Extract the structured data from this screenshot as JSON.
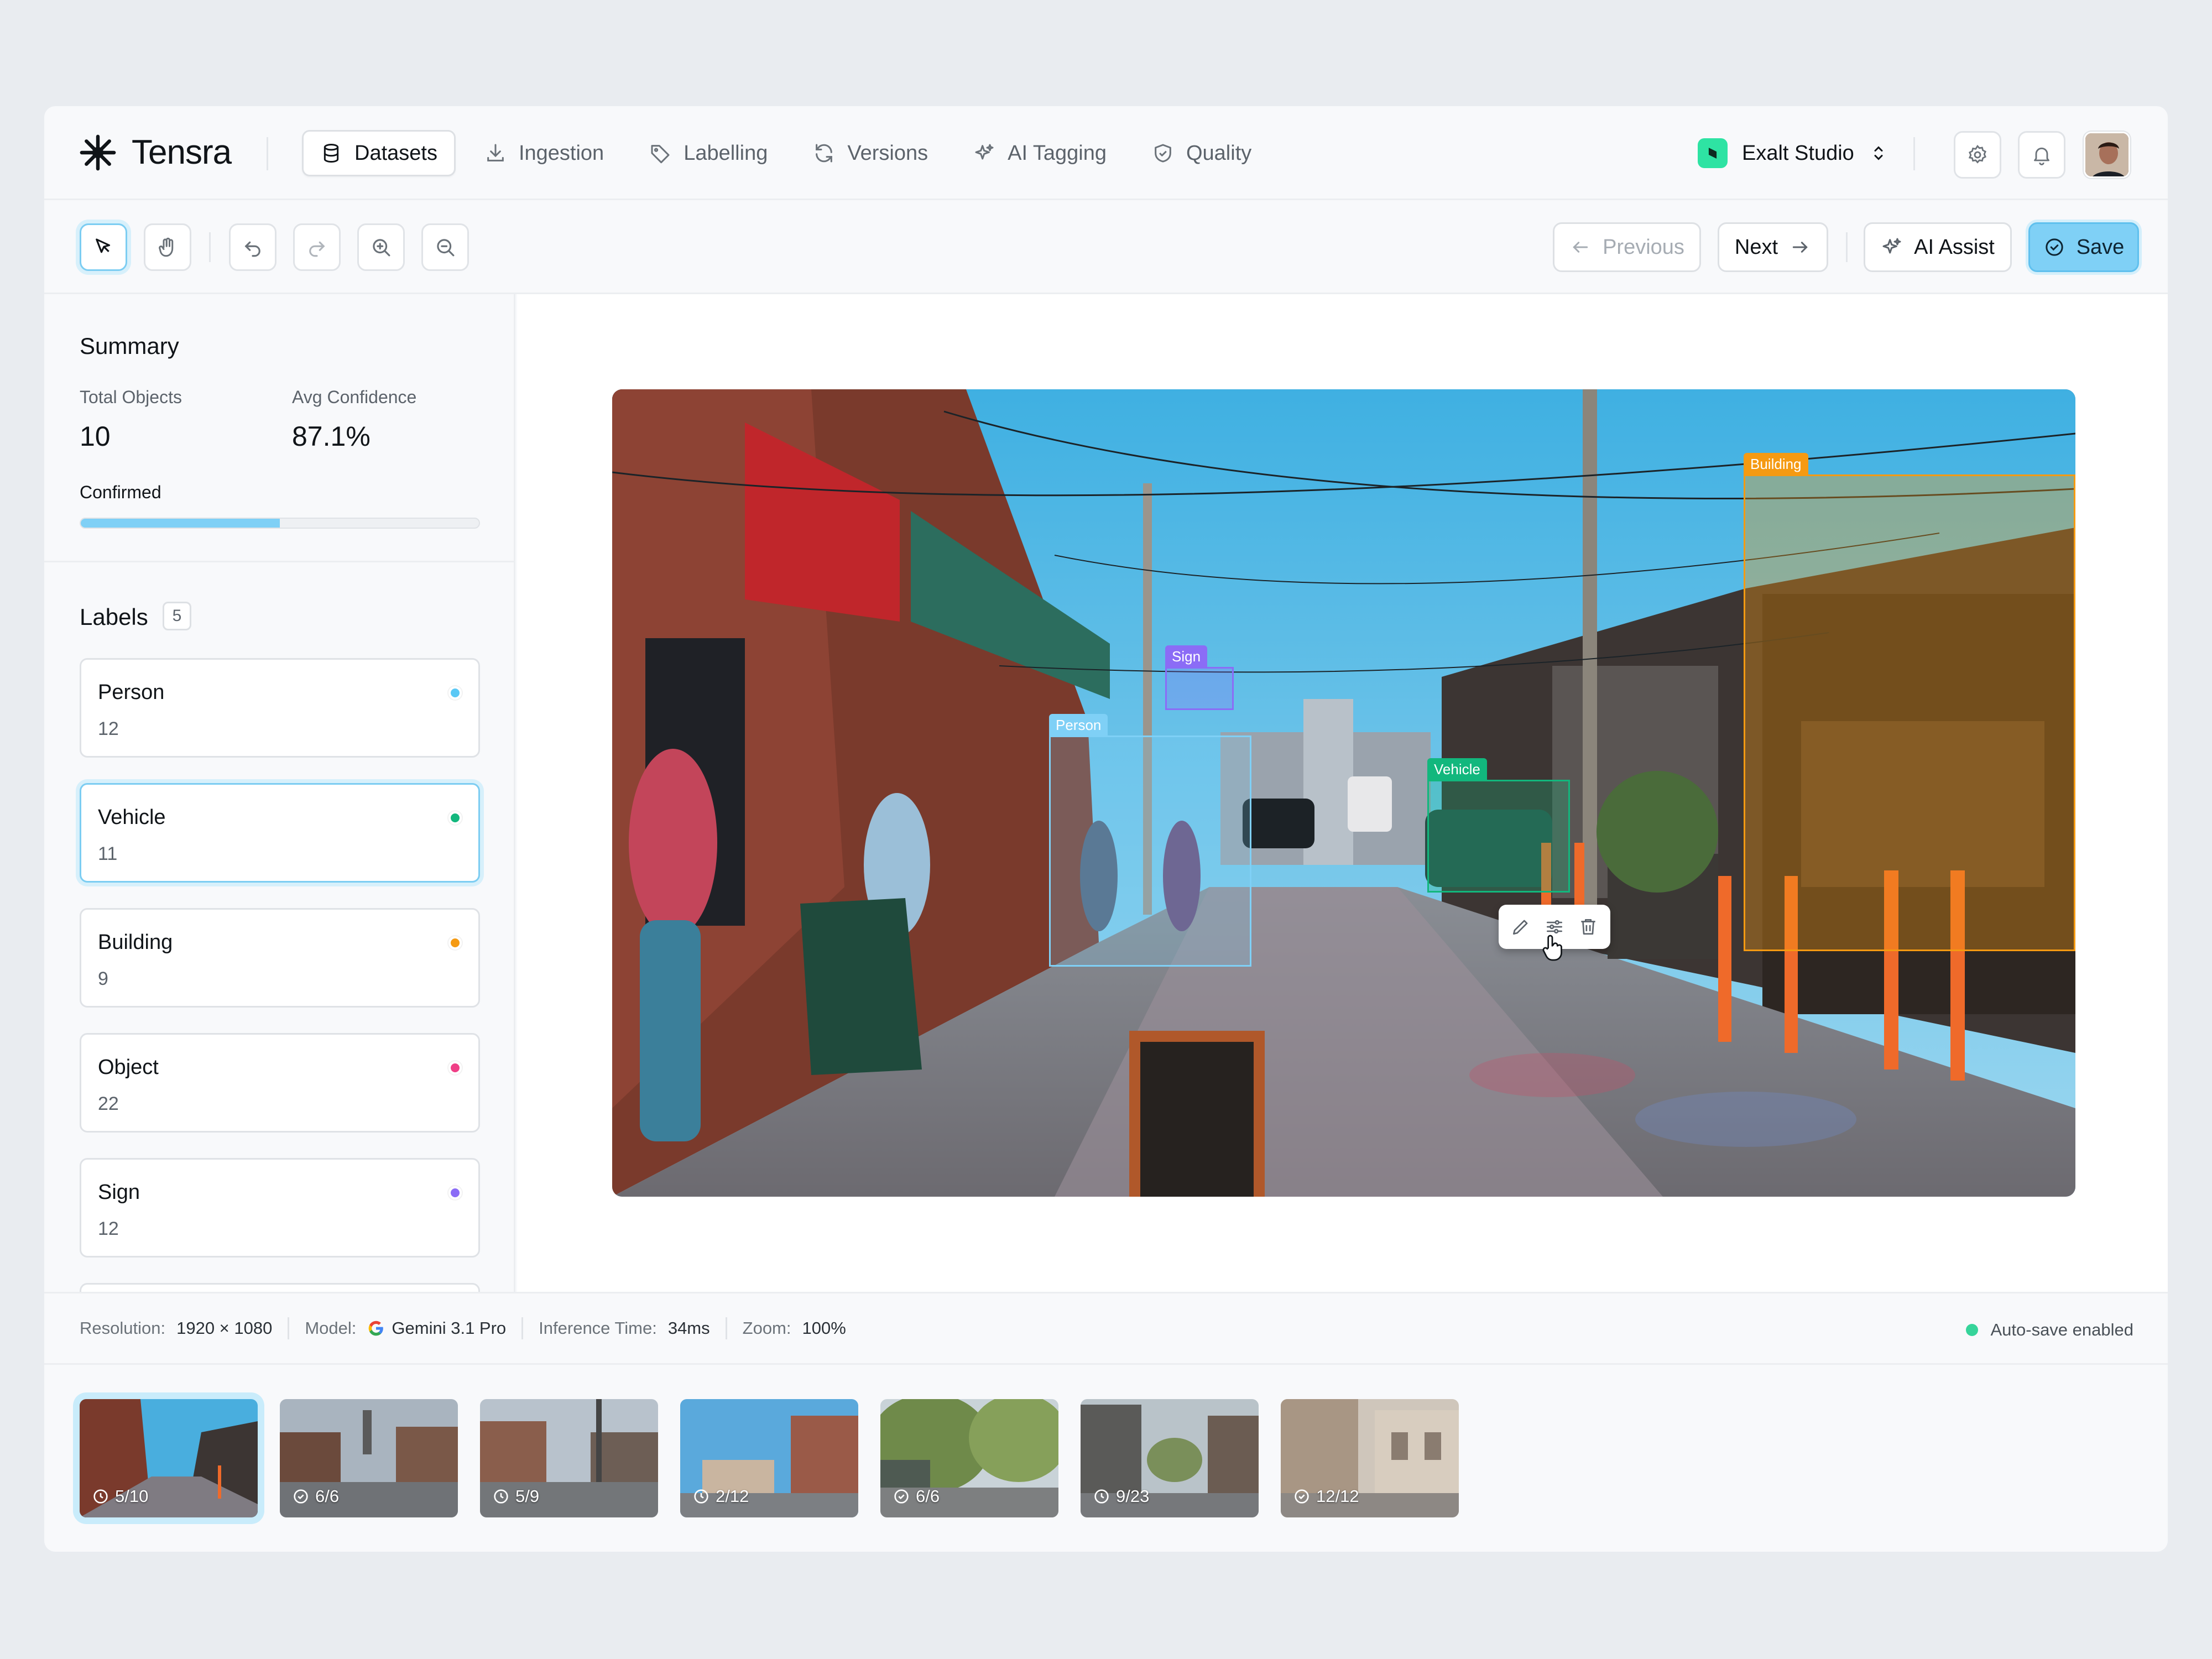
{
  "brand": {
    "name": "Tensra"
  },
  "nav": {
    "tabs": [
      {
        "label": "Datasets",
        "icon": "database-icon"
      },
      {
        "label": "Ingestion",
        "icon": "download-icon"
      },
      {
        "label": "Labelling",
        "icon": "tag-icon"
      },
      {
        "label": "Versions",
        "icon": "refresh-icon"
      },
      {
        "label": "AI Tagging",
        "icon": "sparkles-icon"
      },
      {
        "label": "Quality",
        "icon": "shield-icon"
      }
    ],
    "active_tab": "Datasets",
    "workspace": "Exalt Studio"
  },
  "toolbar": {
    "previous_label": "Previous",
    "next_label": "Next",
    "ai_assist_label": "AI Assist",
    "save_label": "Save"
  },
  "summary": {
    "title": "Summary",
    "total_objects_label": "Total Objects",
    "total_objects": "10",
    "avg_confidence_label": "Avg Confidence",
    "avg_confidence": "87.1%",
    "confirmed_label": "Confirmed",
    "confirmed_fraction": 0.5
  },
  "labels": {
    "title": "Labels",
    "count": "5",
    "items": [
      {
        "name": "Person",
        "count": "12",
        "color": "#5ac8f5"
      },
      {
        "name": "Vehicle",
        "count": "11",
        "color": "#12b77d"
      },
      {
        "name": "Building",
        "count": "9",
        "color": "#f59a12"
      },
      {
        "name": "Object",
        "count": "22",
        "color": "#ef3f86"
      },
      {
        "name": "Sign",
        "count": "12",
        "color": "#8b6cf6"
      }
    ],
    "selected": "Vehicle"
  },
  "annotations": [
    {
      "label": "Sign",
      "color": "#8b6cf6"
    },
    {
      "label": "Person",
      "color": "#5ac8f5"
    },
    {
      "label": "Vehicle",
      "color": "#12b77d"
    },
    {
      "label": "Building",
      "color": "#f59a12"
    }
  ],
  "status": {
    "resolution_label": "Resolution:",
    "resolution": "1920 × 1080",
    "model_label": "Model:",
    "model": "Gemini 3.1 Pro",
    "inference_label": "Inference Time:",
    "inference": "34ms",
    "zoom_label": "Zoom:",
    "zoom": "100%",
    "autosave": "Auto-save enabled"
  },
  "filmstrip": [
    {
      "count": "5/10",
      "state": "pending"
    },
    {
      "count": "6/6",
      "state": "done"
    },
    {
      "count": "5/9",
      "state": "pending"
    },
    {
      "count": "2/12",
      "state": "pending"
    },
    {
      "count": "6/6",
      "state": "done"
    },
    {
      "count": "9/23",
      "state": "pending"
    },
    {
      "count": "12/12",
      "state": "done"
    }
  ]
}
